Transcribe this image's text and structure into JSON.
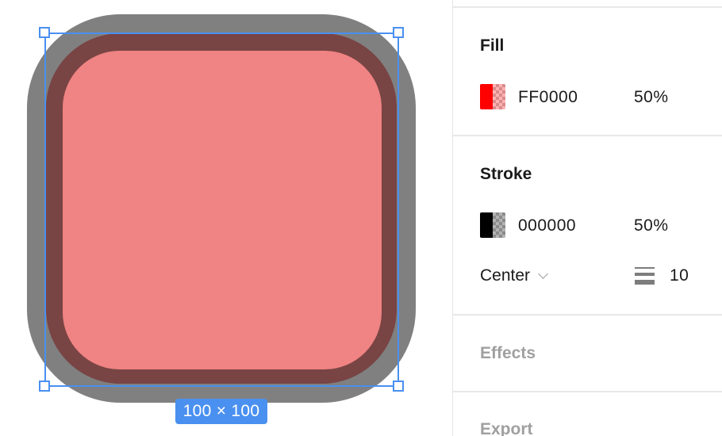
{
  "canvas": {
    "shape": {
      "fill_color": "#F08383",
      "stroke_color": "#794444",
      "outer_color": "#808080"
    },
    "selection": {
      "color": "#4A90F0",
      "dimensions_label": "100 × 100"
    }
  },
  "panel": {
    "fill": {
      "title": "Fill",
      "color_swatch": "#FF0000",
      "hex": "FF0000",
      "opacity": "50%"
    },
    "stroke": {
      "title": "Stroke",
      "color_swatch": "#000000",
      "hex": "000000",
      "opacity": "50%",
      "align": "Center",
      "weight": "10"
    },
    "effects": {
      "title": "Effects"
    },
    "export": {
      "title": "Export"
    }
  }
}
